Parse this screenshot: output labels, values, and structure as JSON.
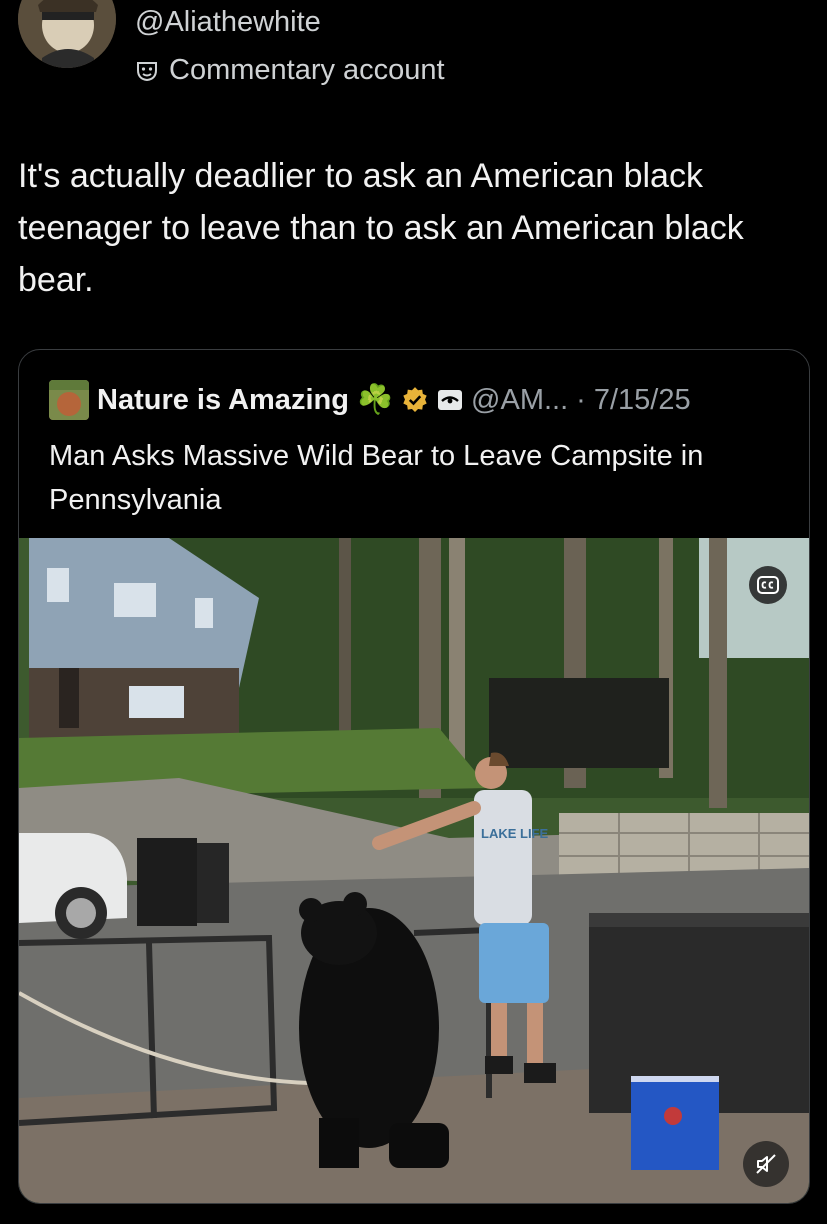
{
  "author": {
    "handle": "@Aliathewhite",
    "label": "Commentary account",
    "label_icon": "parody-mask-icon"
  },
  "post": {
    "text": "It's actually deadlier to ask an American black teenager to leave than to ask an American black bear."
  },
  "quoted": {
    "name": "Nature is Amazing",
    "name_emoji": "☘️",
    "verified_icon": "gold-verified-badge-icon",
    "affiliate_icon": "affiliate-badge-icon",
    "handle": "@AM...",
    "separator": "·",
    "date": "7/15/25",
    "title": "Man Asks Massive Wild Bear to Leave Campsite in Pennsylvania",
    "media": {
      "cc_icon": "closed-captions-icon",
      "mute_icon": "muted-speaker-icon",
      "shirt_text": "LAKE LIFE"
    }
  },
  "colors": {
    "background": "#000000",
    "text": "#e7e9ea",
    "muted": "#9aa0a6",
    "gold": "#e8b339",
    "border": "#3a3d40"
  }
}
